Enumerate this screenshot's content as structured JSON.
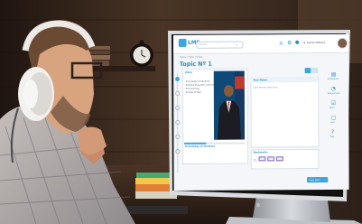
{
  "lms": {
    "app_name": "LMS",
    "search_placeholder": "Search",
    "breadcrumb": "Home / Topic / Video",
    "topic_title": "Topic Nº 1",
    "user_name": "Hi, Darrell Williams",
    "video": {
      "heading": "Video",
      "bullets": [
        "Knowledge of Students",
        "Problem Properties and Characteristics",
        "Self Learning",
        "Review of Task"
      ],
      "section_title": "Knowledge of Students"
    },
    "notes": {
      "heading": "Your Notes",
      "placeholder": "Start taking notes here"
    },
    "bookmarks": {
      "heading": "Bookmarks"
    },
    "right_menu": [
      "All Modules",
      "Assignments",
      "Tasks",
      "Quiz",
      "FAQ"
    ],
    "next_button": "Next Topic"
  },
  "colors": {
    "accent": "#2e8fc5",
    "nav_accent": "#3fa6dd",
    "wall": "#3a281d"
  }
}
